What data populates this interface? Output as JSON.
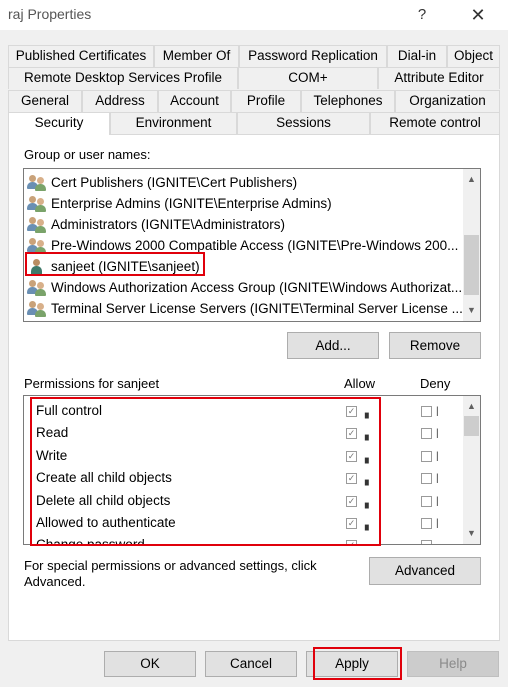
{
  "window": {
    "title": "raj Properties",
    "help_glyph": "?",
    "close_glyph": "✕"
  },
  "tabs": {
    "row1": [
      "Published Certificates",
      "Member Of",
      "Password Replication",
      "Dial-in",
      "Object"
    ],
    "row2": [
      "Remote Desktop Services Profile",
      "COM+",
      "Attribute Editor"
    ],
    "row3": [
      "General",
      "Address",
      "Account",
      "Profile",
      "Telephones",
      "Organization"
    ],
    "row4": [
      "Security",
      "Environment",
      "Sessions",
      "Remote control"
    ],
    "active": "Security"
  },
  "security": {
    "group_label": "Group or user names:",
    "users": [
      "Cert Publishers (IGNITE\\Cert Publishers)",
      "Enterprise Admins (IGNITE\\Enterprise Admins)",
      "Administrators (IGNITE\\Administrators)",
      "Pre-Windows 2000 Compatible Access (IGNITE\\Pre-Windows 200...",
      "sanjeet (IGNITE\\sanjeet)",
      "Windows Authorization Access Group (IGNITE\\Windows Authorizat...",
      "Terminal Server License Servers (IGNITE\\Terminal Server License ..."
    ],
    "selected_user_index": 4,
    "add_label": "Add...",
    "remove_label": "Remove",
    "permissions_label": "Permissions for sanjeet",
    "allow_header": "Allow",
    "deny_header": "Deny",
    "permissions": [
      {
        "name": "Full control",
        "allow": true,
        "deny": false
      },
      {
        "name": "Read",
        "allow": true,
        "deny": false
      },
      {
        "name": "Write",
        "allow": true,
        "deny": false
      },
      {
        "name": "Create all child objects",
        "allow": true,
        "deny": false
      },
      {
        "name": "Delete all child objects",
        "allow": true,
        "deny": false
      },
      {
        "name": "Allowed to authenticate",
        "allow": true,
        "deny": false
      },
      {
        "name": "Change password",
        "allow": true,
        "deny": false
      }
    ],
    "advanced_text": "For special permissions or advanced settings, click Advanced.",
    "advanced_label": "Advanced"
  },
  "footer": {
    "ok": "OK",
    "cancel": "Cancel",
    "apply": "Apply",
    "help": "Help"
  },
  "colors": {
    "highlight_red": "#e0000b",
    "panel": "#ffffff",
    "window": "#f0f0f0"
  }
}
